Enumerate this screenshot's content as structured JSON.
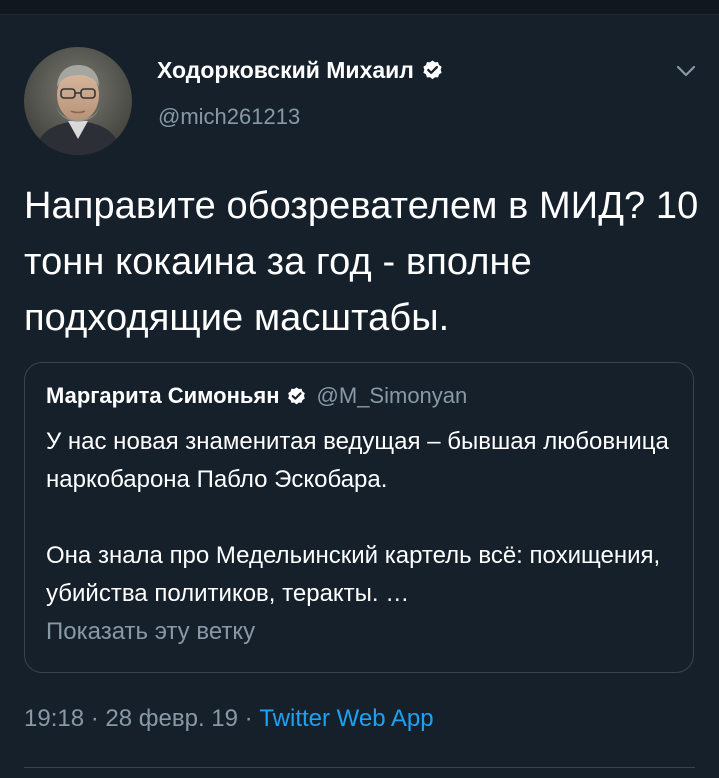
{
  "colors": {
    "background": "#15202b",
    "text_primary": "#ffffff",
    "text_secondary": "#8899a6",
    "accent": "#1da1f2",
    "border": "#38444d"
  },
  "tweet": {
    "author": {
      "name": "Ходорковский Михаил",
      "handle": "@mich261213",
      "verified": true,
      "avatar_icon": "avatar-photo"
    },
    "menu_icon": "chevron-down-icon",
    "text": "Направите обозревателем в МИД? 10 тонн кокаина за год - вполне подходящие масштабы.",
    "quoted_tweet": {
      "author_name": "Маргарита Симоньян",
      "verified": true,
      "handle": "@M_Simonyan",
      "paragraph_1": "У нас новая знаменитая ведущая – бывшая любовница наркобарона Пабло Эскобара.",
      "paragraph_2": "Она знала про Медельинский картель всё: похищения, убийства политиков, теракты. …",
      "show_thread": "Показать эту ветку"
    },
    "meta": {
      "time": "19:18",
      "separator_1": " · ",
      "date": "28 февр. 19",
      "separator_2": " · ",
      "source": "Twitter Web App"
    }
  }
}
